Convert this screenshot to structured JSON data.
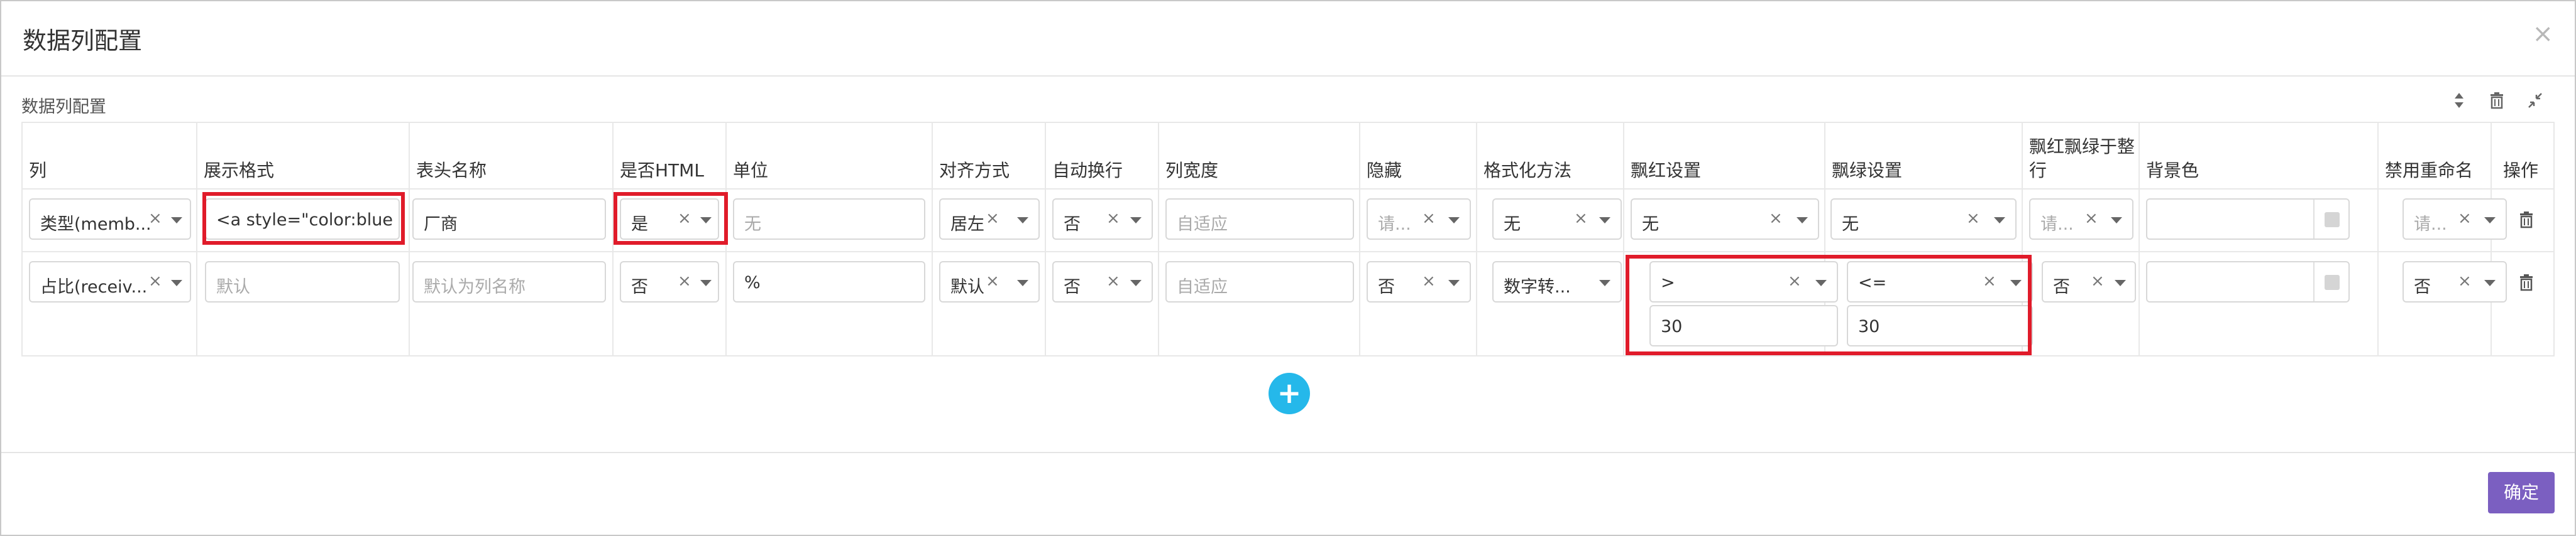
{
  "dialog": {
    "title": "数据列配置",
    "close": "×"
  },
  "panel": {
    "title": "数据列配置"
  },
  "headers": {
    "col": "列",
    "format": "展示格式",
    "header_name": "表头名称",
    "is_html": "是否HTML",
    "unit": "单位",
    "align": "对齐方式",
    "wrap": "自动换行",
    "width": "列宽度",
    "hide": "隐藏",
    "formatter": "格式化方法",
    "red": "飘红设置",
    "green": "飘绿设置",
    "integer_line1": "飘红飘绿于整",
    "integer_line2": "行",
    "bg": "背景色",
    "no_rename": "禁用重命名",
    "ops": "操作"
  },
  "rows": [
    {
      "col": "类型(memb...",
      "format": "<a style=\"color:blue",
      "header_name": "厂商",
      "is_html": "是",
      "unit": "无",
      "align": "居左",
      "wrap": "否",
      "width": "自适应",
      "hide": "请...",
      "formatter": "无",
      "red": "无",
      "green": "无",
      "integer": "请...",
      "bg": "",
      "no_rename": "请..."
    },
    {
      "col": "占比(receiv...",
      "format": "默认",
      "header_name": "默认为列名称",
      "is_html": "否",
      "unit": "%",
      "align": "默认",
      "wrap": "否",
      "width": "自适应",
      "hide": "否",
      "formatter": "数字转...",
      "red": ">",
      "red_value": "30",
      "green": "<=",
      "green_value": "30",
      "integer": "否",
      "bg": "",
      "no_rename": "否"
    }
  ],
  "clear": "×",
  "footer": {
    "ok": "确定"
  },
  "add_symbol": "+",
  "colors": {
    "accent": "#25b8ea",
    "primary_button": "#7b5fc1",
    "highlight": "#e01b2a"
  }
}
